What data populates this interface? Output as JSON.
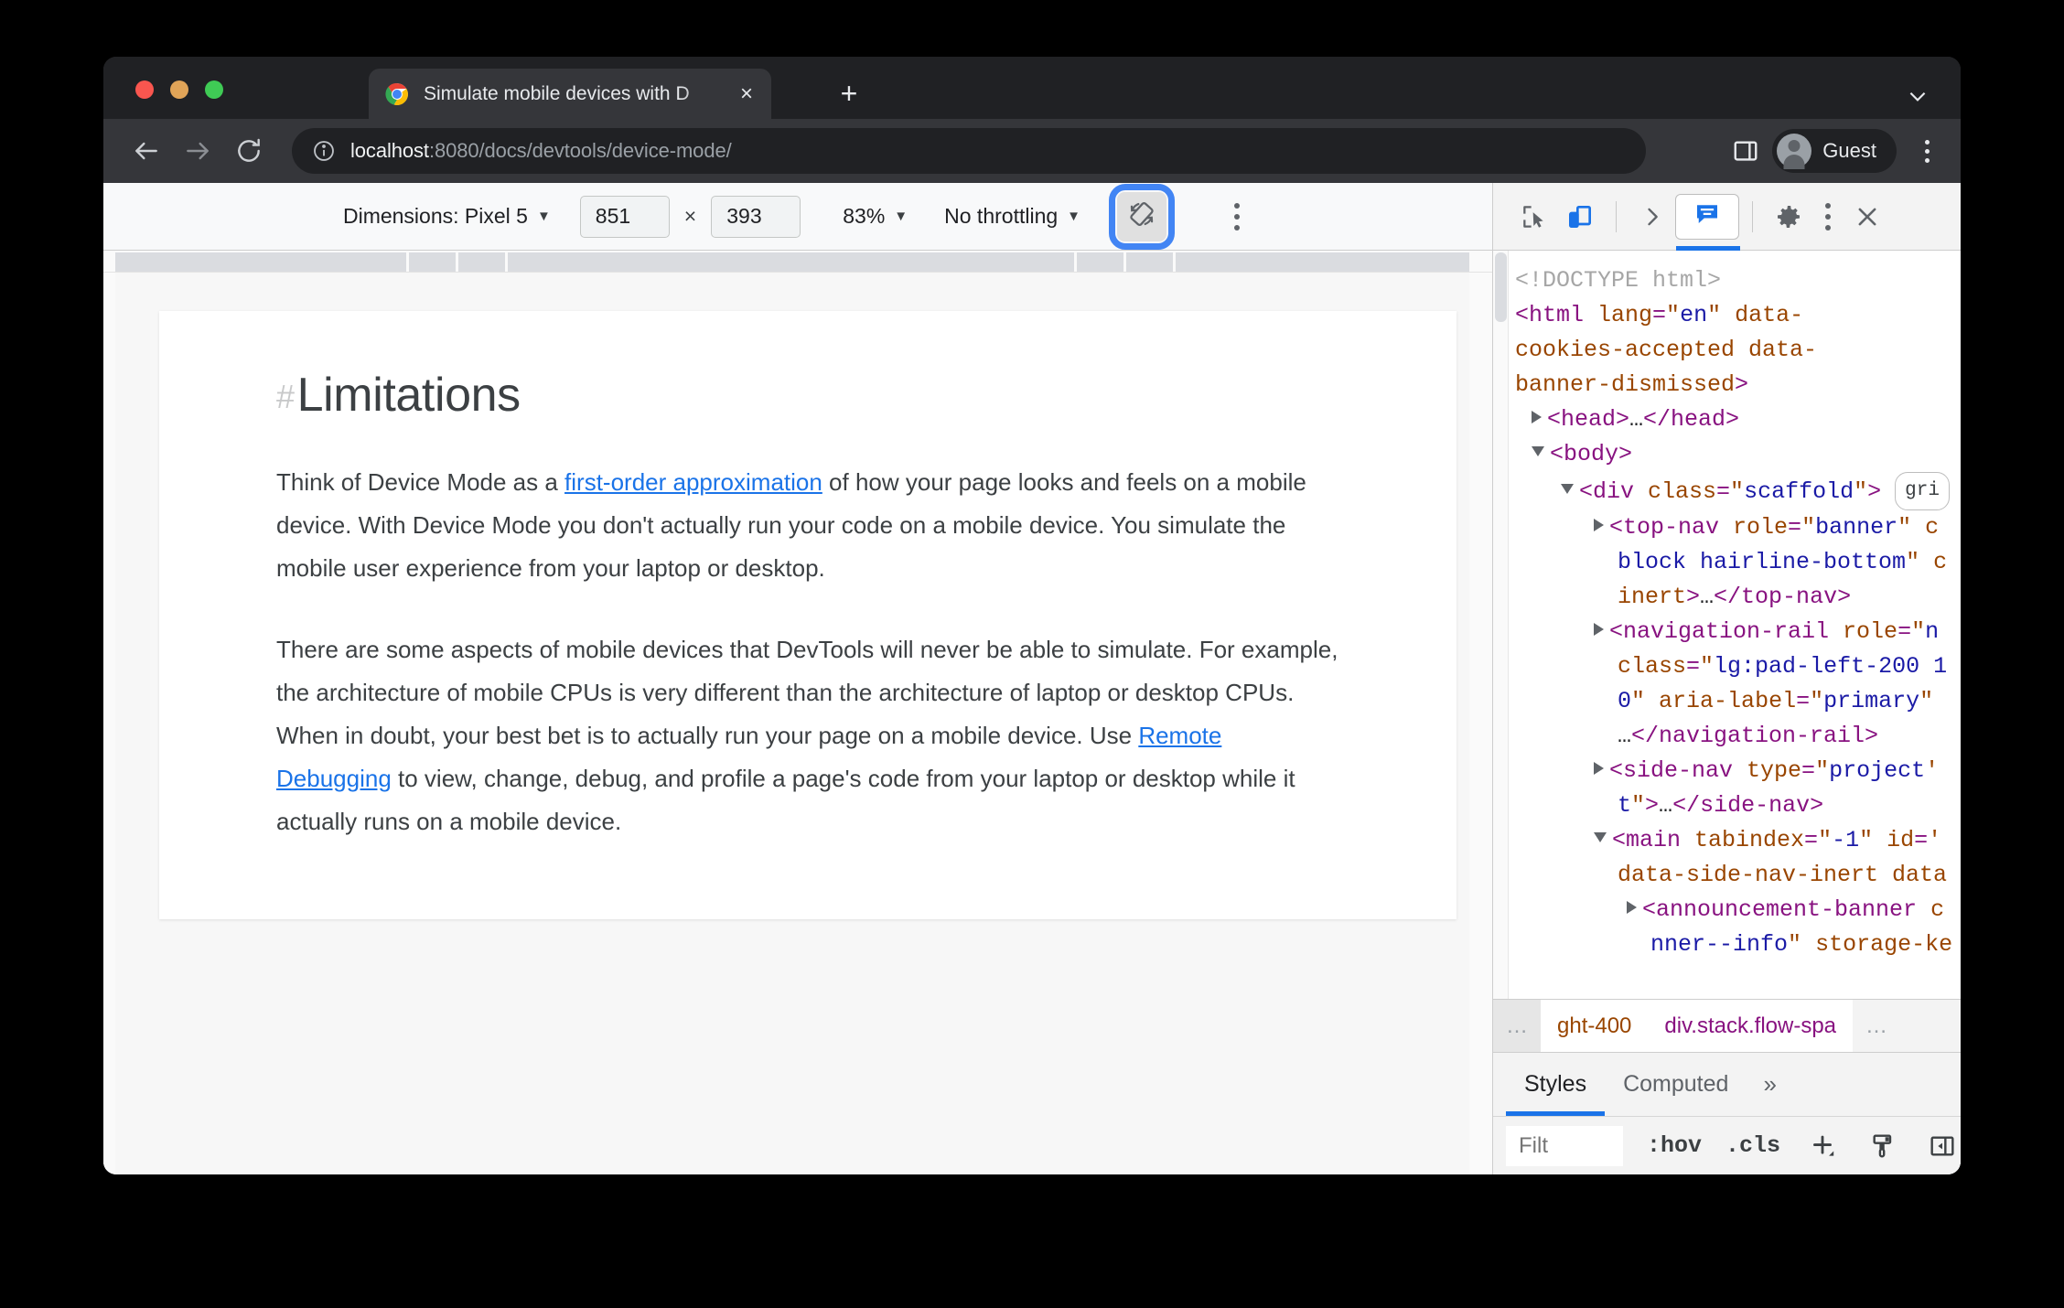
{
  "browser": {
    "tab": {
      "title": "Simulate mobile devices with D",
      "close_label": "×"
    },
    "new_tab_label": "+",
    "omnibox": {
      "host": "localhost",
      "path": ":8080/docs/devtools/device-mode/"
    },
    "profile_name": "Guest"
  },
  "device_toolbar": {
    "dimensions_label": "Dimensions: Pixel 5",
    "width": "851",
    "height": "393",
    "multiply": "×",
    "zoom": "83%",
    "throttling": "No throttling",
    "caret": "▼"
  },
  "page": {
    "heading_hash": "#",
    "heading": "Limitations",
    "paragraph1_before": "Think of Device Mode as a ",
    "paragraph1_link": "first-order approximation",
    "paragraph1_after": " of how your page looks and feels on a mobile device. With Device Mode you don't actually run your code on a mobile device. You simulate the mobile user experience from your laptop or desktop.",
    "paragraph2_before": "There are some aspects of mobile devices that DevTools will never be able to simulate. For example, the architecture of mobile CPUs is very different than the architecture of laptop or desktop CPUs. When in doubt, your best bet is to actually run your page on a mobile device. Use ",
    "paragraph2_link": "Remote Debugging",
    "paragraph2_after": " to view, change, debug, and profile a page's code from your laptop or desktop while it actually runs on a mobile device."
  },
  "devtools": {
    "dom_lines": [
      "<!DOCTYPE html>",
      "<html lang=\"en\" data-cookies-accepted data-banner-dismissed>",
      "<head>…</head>",
      "<body>",
      "<div class=\"scaffold\">",
      "gri",
      "<top-nav role=\"banner\" c block hairline-bottom\" c inert>…</top-nav>",
      "<navigation-rail role=\"n class=\"lg:pad-left-200 1 0\" aria-label=\"primary\" …</navigation-rail>",
      "<side-nav type=\"project\" t\">…</side-nav>",
      "<main tabindex=\"-1\" id=\" data-side-nav-inert data",
      "<announcement-banner c nner--info\" storage-ke"
    ],
    "breadcrumb": {
      "left_ellipsis": "…",
      "parent": "ght-400",
      "selected": "div.stack.flow-spa",
      "right_ellipsis": "…"
    },
    "sidebar_tabs": [
      {
        "label": "Styles",
        "active": true
      },
      {
        "label": "Computed",
        "active": false
      }
    ],
    "sidebar_more": "»",
    "styles_toolbar": {
      "filter_placeholder": "Filt",
      "hov": ":hov",
      "cls": ".cls"
    }
  }
}
